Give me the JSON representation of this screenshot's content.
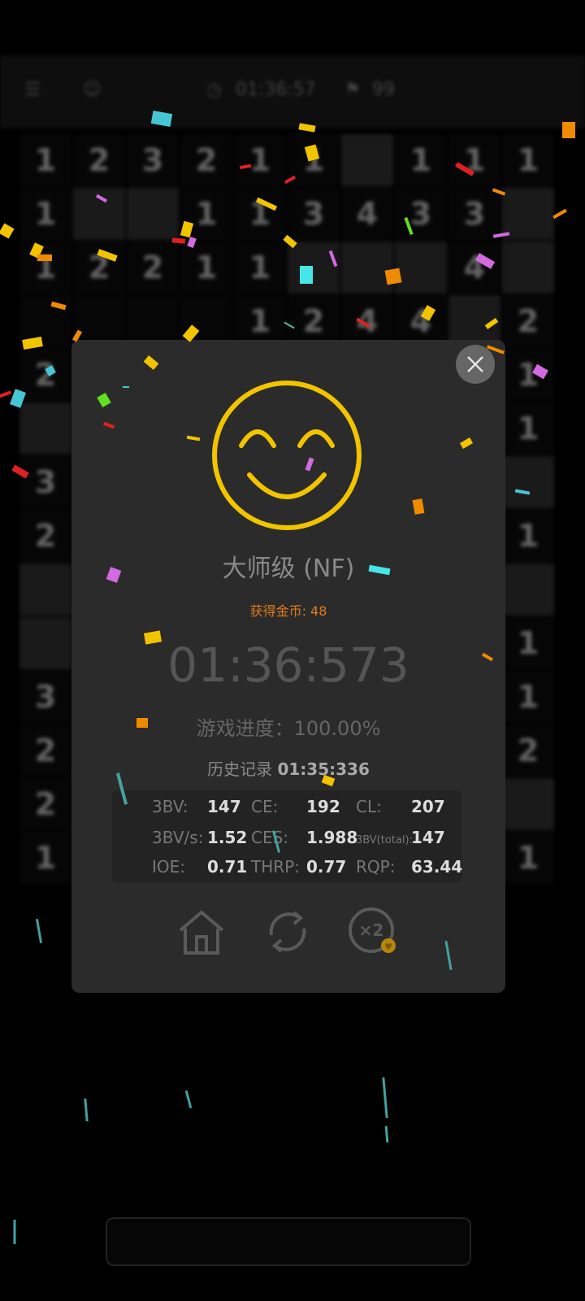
{
  "topbar": {
    "timer": "01:36:57",
    "flags": "99"
  },
  "board": {
    "rows": [
      [
        "1",
        "2",
        "3",
        "2",
        "1",
        "1",
        "#",
        "1",
        "1",
        "1"
      ],
      [
        "1",
        "#",
        "#",
        "1",
        "1",
        "3",
        "4",
        "3",
        "3",
        "#"
      ],
      [
        "1",
        "2",
        "2",
        "1",
        "1",
        "#",
        "#",
        "#",
        "4",
        "#"
      ],
      [
        "",
        "",
        "",
        "",
        "1",
        "2",
        "4",
        "4",
        "#",
        "2"
      ],
      [
        "2",
        "",
        "",
        "",
        "",
        "",
        "",
        "",
        "",
        "1"
      ],
      [
        "#",
        "",
        "",
        "",
        "",
        "",
        "",
        "",
        "",
        "1"
      ],
      [
        "3",
        "",
        "",
        "",
        "",
        "",
        "",
        "",
        "",
        "#"
      ],
      [
        "2",
        "",
        "",
        "",
        "",
        "",
        "",
        "",
        "",
        "1"
      ],
      [
        "#",
        "",
        "",
        "",
        "",
        "",
        "",
        "",
        "",
        "#"
      ],
      [
        "#",
        "",
        "",
        "",
        "",
        "",
        "",
        "",
        "",
        "1"
      ],
      [
        "3",
        "",
        "",
        "",
        "",
        "",
        "",
        "",
        "",
        "1"
      ],
      [
        "2",
        "",
        "",
        "",
        "",
        "",
        "",
        "",
        "",
        "2"
      ],
      [
        "2",
        "",
        "",
        "",
        "",
        "",
        "",
        "",
        "",
        "#"
      ],
      [
        "1",
        "",
        "",
        "",
        "",
        "",
        "",
        "",
        "",
        "1"
      ]
    ]
  },
  "result": {
    "level": "大师级 (NF)",
    "coins": "获得金币: 48",
    "time": "01:36:573",
    "progress": "游戏进度：100.00%",
    "record_label": "历史记录",
    "record_value": "01:35:336"
  },
  "stats": [
    {
      "label": "3BV:",
      "value": "147"
    },
    {
      "label": "CE:",
      "value": "192"
    },
    {
      "label": "CL:",
      "value": "207"
    },
    {
      "label": "3BV/s:",
      "value": "1.52"
    },
    {
      "label": "CES:",
      "value": "1.988"
    },
    {
      "label": "3BV(total):",
      "value": "147"
    },
    {
      "label": "IOE:",
      "value": "0.71"
    },
    {
      "label": "THRP:",
      "value": "0.77"
    },
    {
      "label": "RQP:",
      "value": "63.44"
    }
  ],
  "actions": {
    "double_label": "×2",
    "icons": [
      "home-icon",
      "refresh-icon",
      "double-coin-icon",
      "close-icon",
      "smiley-icon"
    ]
  },
  "colors": {
    "accent": "#f2c400",
    "coin": "#e07b1a",
    "modal": "#2b2b2b"
  }
}
